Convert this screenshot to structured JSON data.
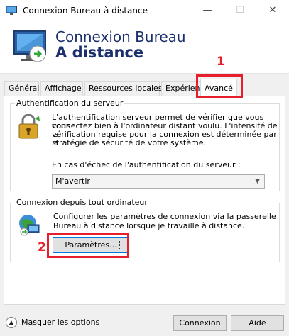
{
  "window": {
    "title": "Connexion Bureau à distance",
    "minimize_icon": "minimize-icon",
    "maximize_icon": "maximize-icon",
    "close_icon": "close-icon"
  },
  "header": {
    "brand_line1": "Connexion Bureau",
    "brand_line2": "A distance",
    "icon": "remote-desktop-icon"
  },
  "tabs": [
    {
      "label": "Général",
      "active": false
    },
    {
      "label": "Affichage",
      "active": false
    },
    {
      "label": "Ressources locales",
      "active": false
    },
    {
      "label": "Expérience",
      "active": false
    },
    {
      "label": "Avancé",
      "active": true
    }
  ],
  "server_auth": {
    "group_title": "Authentification du serveur",
    "icon": "padlock-icon",
    "description": [
      "L'authentification serveur permet de vérifier que vous vous",
      "connectez bien à l'ordinateur distant voulu. L'intensité de la",
      "vérification requise pour la connexion est déterminée par la",
      "stratégie de sécurité de votre système."
    ],
    "dropdown_label": "En cas d'échec de l'authentification du serveur :",
    "dropdown_value": "M'avertir"
  },
  "connect_anywhere": {
    "group_title": "Connexion depuis tout ordinateur",
    "icon": "network-computer-icon",
    "description": [
      "Configurer les paramètres de connexion via la passerelle",
      "Bureau à distance lorsque je travaille à distance."
    ],
    "settings_button": "Paramètres..."
  },
  "annotations": {
    "marker_1": "1",
    "marker_2": "2",
    "color": "#e51f2c"
  },
  "footer": {
    "options_toggle": "Masquer les options",
    "connect_button": "Connexion",
    "help_button": "Aide"
  },
  "colors": {
    "brand": "#1a2f6b",
    "focus": "#0078d7",
    "annotation": "#e51f2c"
  }
}
